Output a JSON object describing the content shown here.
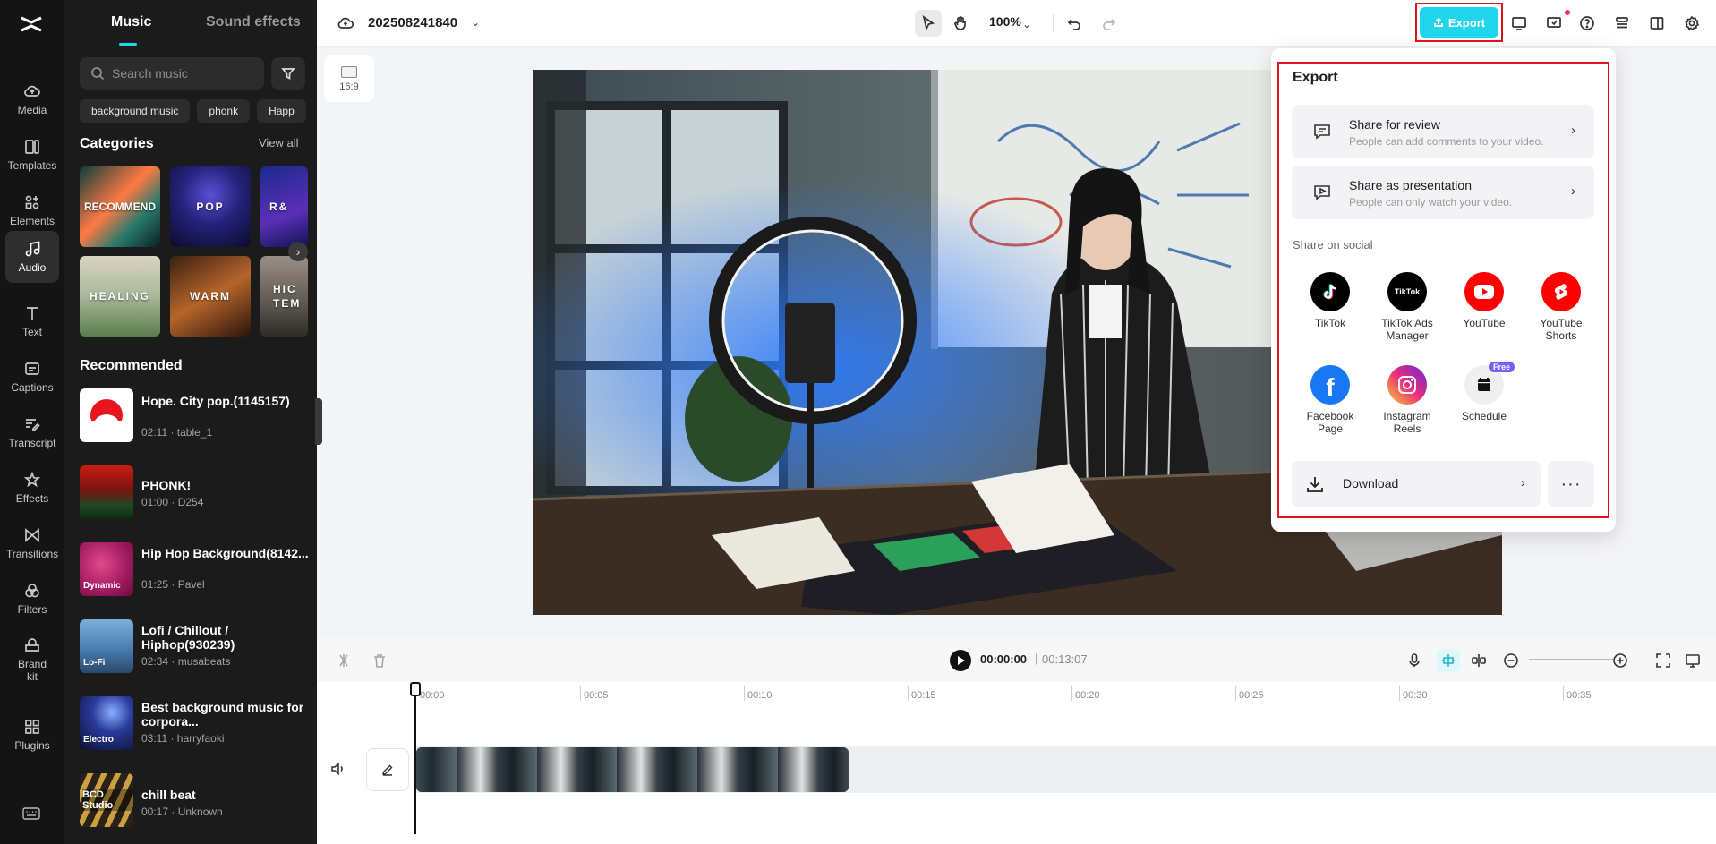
{
  "rail": {
    "items": [
      {
        "label": "Media",
        "icon": "cloud-icon"
      },
      {
        "label": "Templates",
        "icon": "templates-icon"
      },
      {
        "label": "Elements",
        "icon": "elements-icon"
      },
      {
        "label": "Audio",
        "icon": "music-note-icon",
        "active": true
      },
      {
        "label": "Text",
        "icon": "text-icon"
      },
      {
        "label": "Captions",
        "icon": "captions-icon"
      },
      {
        "label": "Transcript",
        "icon": "transcript-icon"
      },
      {
        "label": "Effects",
        "icon": "effects-icon"
      },
      {
        "label": "Transitions",
        "icon": "transitions-icon"
      },
      {
        "label": "Filters",
        "icon": "filters-icon"
      },
      {
        "label": "Brand kit",
        "icon": "brand-kit-icon"
      },
      {
        "label": "Plugins",
        "icon": "plugins-icon"
      }
    ]
  },
  "panel": {
    "tabs": {
      "music": "Music",
      "sfx": "Sound effects"
    },
    "search_placeholder": "Search music",
    "chips": [
      "background music",
      "phonk",
      "Happ"
    ],
    "categories_title": "Categories",
    "view_all": "View all",
    "categories": [
      "RECOMMEND",
      "POP",
      "R&",
      "HEALING",
      "WARM",
      "HIC TEM"
    ],
    "recommended_title": "Recommended",
    "tracks": [
      {
        "title": "Hope. City pop.(1145157)",
        "meta": "02:11 · table_1",
        "badge": ""
      },
      {
        "title": "PHONK!",
        "meta": "01:00 · D254",
        "badge": ""
      },
      {
        "title": "Hip Hop Background(8142...",
        "meta": "01:25 · Pavel",
        "badge": "Dynamic"
      },
      {
        "title": "Lofi / Chillout / Hiphop(930239)",
        "meta": "02:34 · musabeats",
        "badge": "Lo-Fi"
      },
      {
        "title": "Best background music for corpora...",
        "meta": "03:11 · harryfaoki",
        "badge": "Electro"
      },
      {
        "title": "chill beat",
        "meta": "00:17 · Unknown",
        "badge": "BCD Studio"
      }
    ]
  },
  "topbar": {
    "project_name": "202508241840",
    "zoom": "100%",
    "export_label": "Export"
  },
  "canvas": {
    "ratio": "16:9"
  },
  "export_dialog": {
    "title": "Export",
    "share_review": {
      "title": "Share for review",
      "subtitle": "People can add comments to your video."
    },
    "share_presentation": {
      "title": "Share as presentation",
      "subtitle": "People can only watch your video."
    },
    "social_label": "Share on social",
    "social": [
      {
        "name": "TikTok",
        "color": "#000000"
      },
      {
        "name": "TikTok Ads Manager",
        "color": "#000000",
        "logo_text": "TikTok"
      },
      {
        "name": "YouTube",
        "color": "#ff0000"
      },
      {
        "name": "YouTube Shorts",
        "color": "#ff0000"
      },
      {
        "name": "Facebook Page",
        "color": "#1877f2"
      },
      {
        "name": "Instagram Reels",
        "color": "#d6249f"
      },
      {
        "name": "Schedule",
        "color": "#f0f0f0"
      }
    ],
    "free_badge": "Free",
    "download": "Download",
    "more": "···"
  },
  "timeline": {
    "current_time": "00:00:00",
    "separator": "|",
    "total_time": "00:13:07",
    "ticks": [
      "00:00",
      "00:05",
      "00:10",
      "00:15",
      "00:20",
      "00:25",
      "00:30",
      "00:35"
    ]
  },
  "colors": {
    "accent": "#20d5ec",
    "highlight": "#e0141e"
  }
}
